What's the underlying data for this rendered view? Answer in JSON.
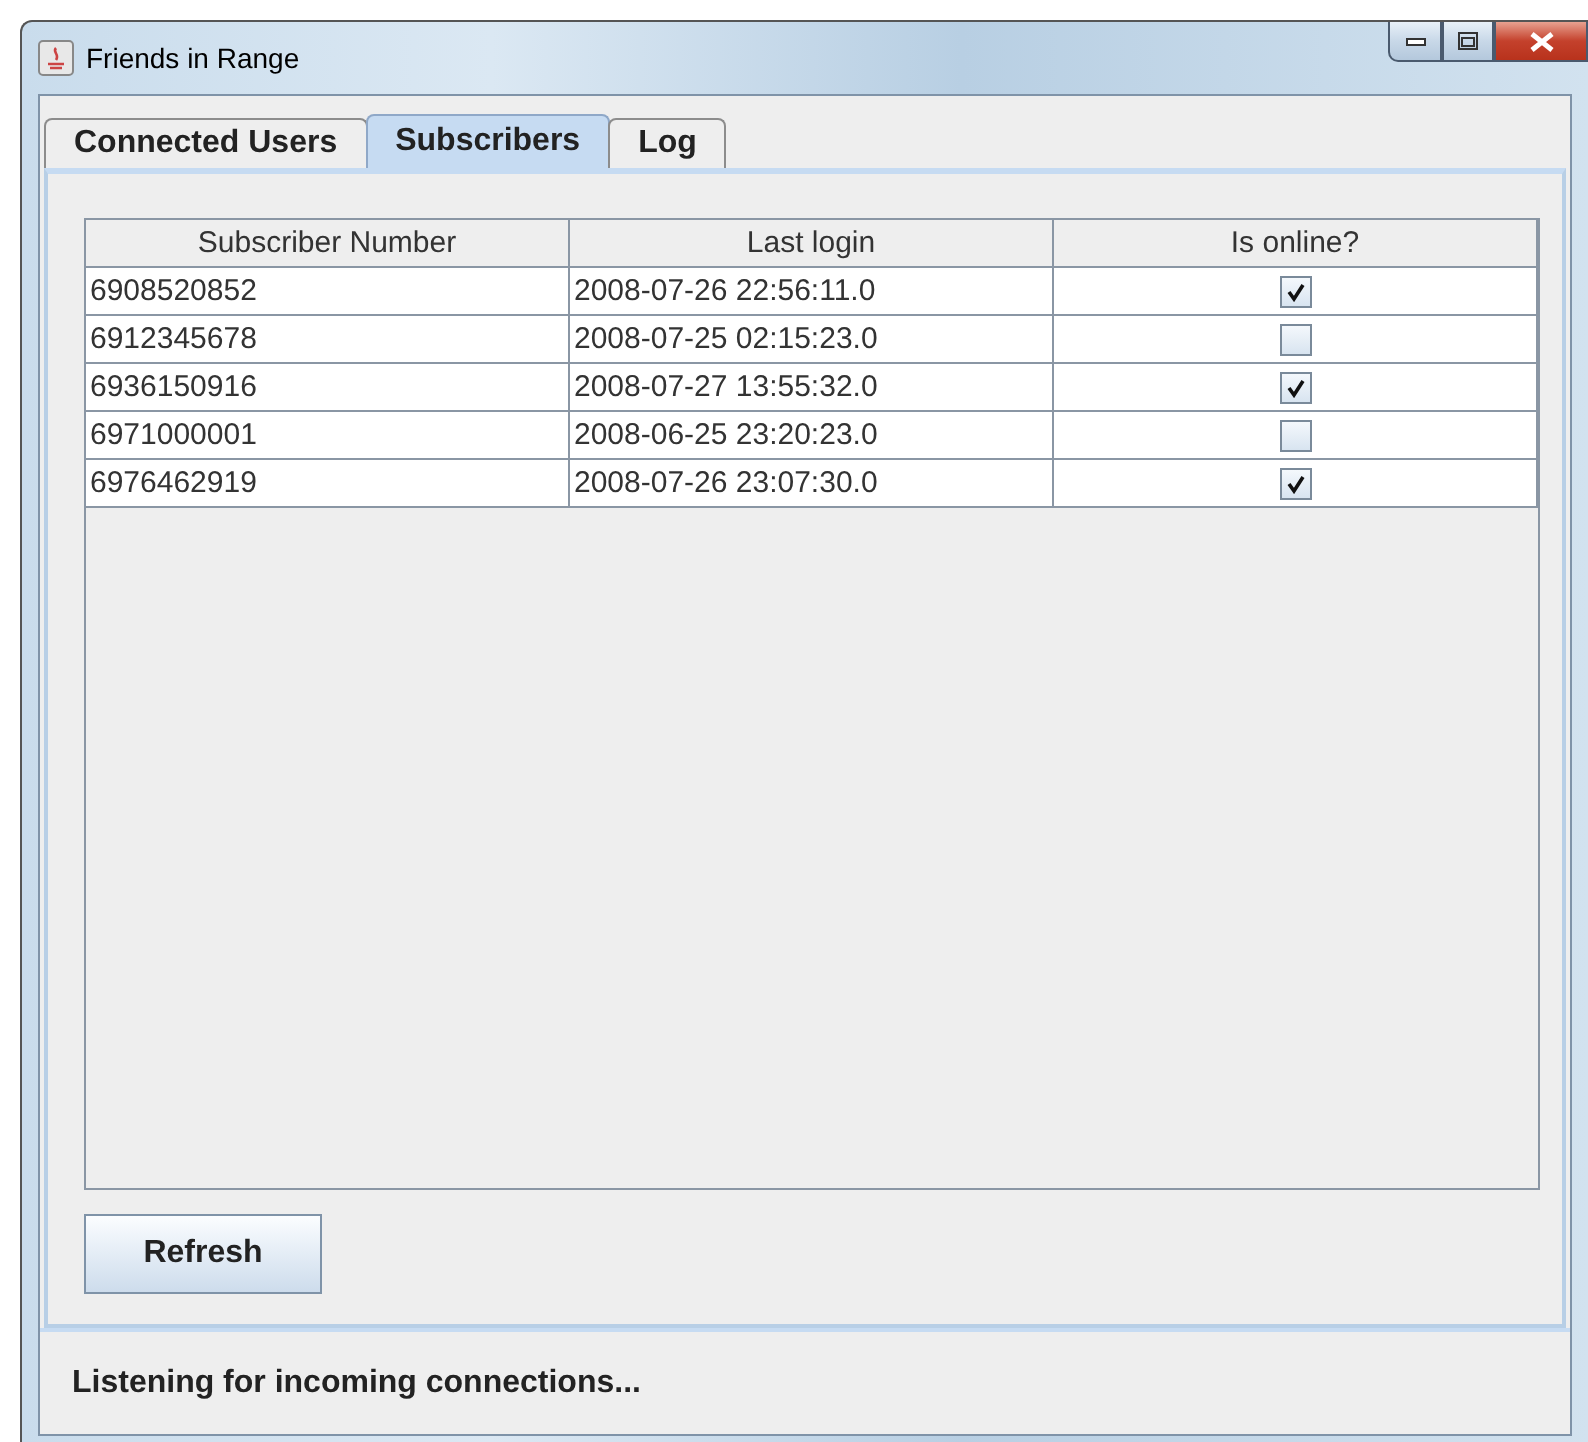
{
  "window": {
    "title": "Friends in Range"
  },
  "tabs": [
    {
      "label": "Connected Users",
      "selected": false
    },
    {
      "label": "Subscribers",
      "selected": true
    },
    {
      "label": "Log",
      "selected": false
    }
  ],
  "table": {
    "columns": [
      "Subscriber Number",
      "Last login",
      "Is online?"
    ],
    "rows": [
      {
        "number": "6908520852",
        "last_login": "2008-07-26 22:56:11.0",
        "online": true
      },
      {
        "number": "6912345678",
        "last_login": "2008-07-25 02:15:23.0",
        "online": false
      },
      {
        "number": "6936150916",
        "last_login": "2008-07-27 13:55:32.0",
        "online": true
      },
      {
        "number": "6971000001",
        "last_login": "2008-06-25 23:20:23.0",
        "online": false
      },
      {
        "number": "6976462919",
        "last_login": "2008-07-26 23:07:30.0",
        "online": true
      }
    ]
  },
  "buttons": [
    "Refresh"
  ],
  "status_bar": "Listening for incoming connections..."
}
